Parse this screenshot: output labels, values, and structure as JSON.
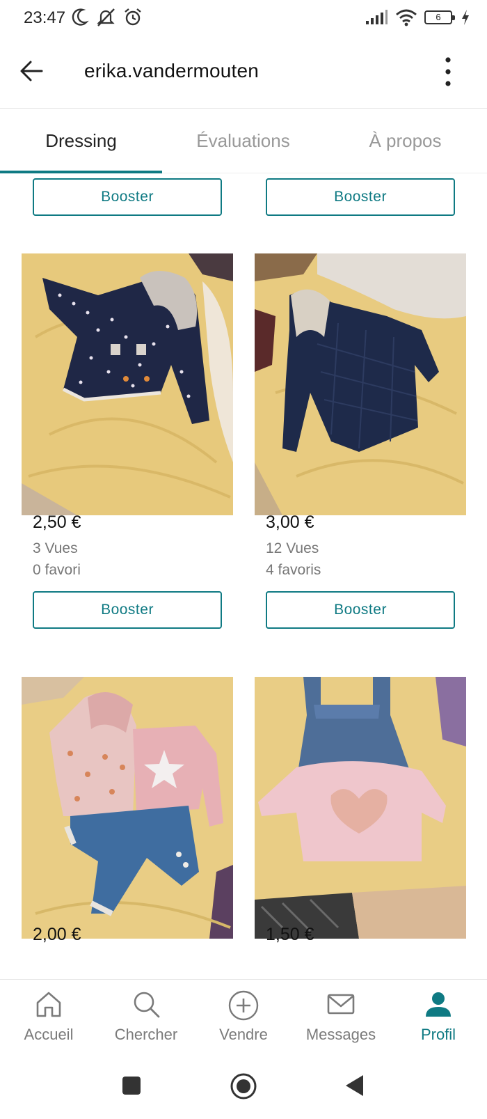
{
  "status_bar": {
    "time": "23:47",
    "battery": "6",
    "icons": [
      "moon-icon",
      "muted-bell-icon",
      "alarm-icon",
      "signal-icon",
      "wifi-icon",
      "battery-icon",
      "charging-icon"
    ]
  },
  "header": {
    "username": "erika.vandermouten",
    "back_icon": "arrow-left-icon",
    "menu_icon": "more-vertical-icon"
  },
  "tabs": [
    {
      "label": "Dressing",
      "active": true
    },
    {
      "label": "Évaluations",
      "active": false
    },
    {
      "label": "À propos",
      "active": false
    }
  ],
  "listings": {
    "top_boost_buttons": [
      "Booster",
      "Booster"
    ],
    "items": [
      {
        "price": "2,50 €",
        "views": "3 Vues",
        "favorites": "0 favori",
        "boost_label": "Booster",
        "image": "navy polka-dot baby jacket on yellow bedspread"
      },
      {
        "price": "3,00 €",
        "views": "12 Vues",
        "favorites": "4 favoris",
        "boost_label": "Booster",
        "image": "navy quilted hooded baby coat on yellow bedspread"
      },
      {
        "price": "2,00 €",
        "image": "pink hoodie, star top and blue trousers set"
      },
      {
        "price": "1,50 €",
        "image": "denim pinafore dress with pink heart top"
      }
    ]
  },
  "bottom_nav": [
    {
      "label": "Accueil",
      "icon": "home-icon",
      "active": false
    },
    {
      "label": "Chercher",
      "icon": "search-icon",
      "active": false
    },
    {
      "label": "Vendre",
      "icon": "plus-circle-icon",
      "active": false
    },
    {
      "label": "Messages",
      "icon": "envelope-icon",
      "active": false
    },
    {
      "label": "Profil",
      "icon": "user-icon",
      "active": true
    }
  ],
  "colors": {
    "accent": "#0f7a83",
    "inactive": "#7a7a7a",
    "bed_yellow": "#e6c878"
  }
}
